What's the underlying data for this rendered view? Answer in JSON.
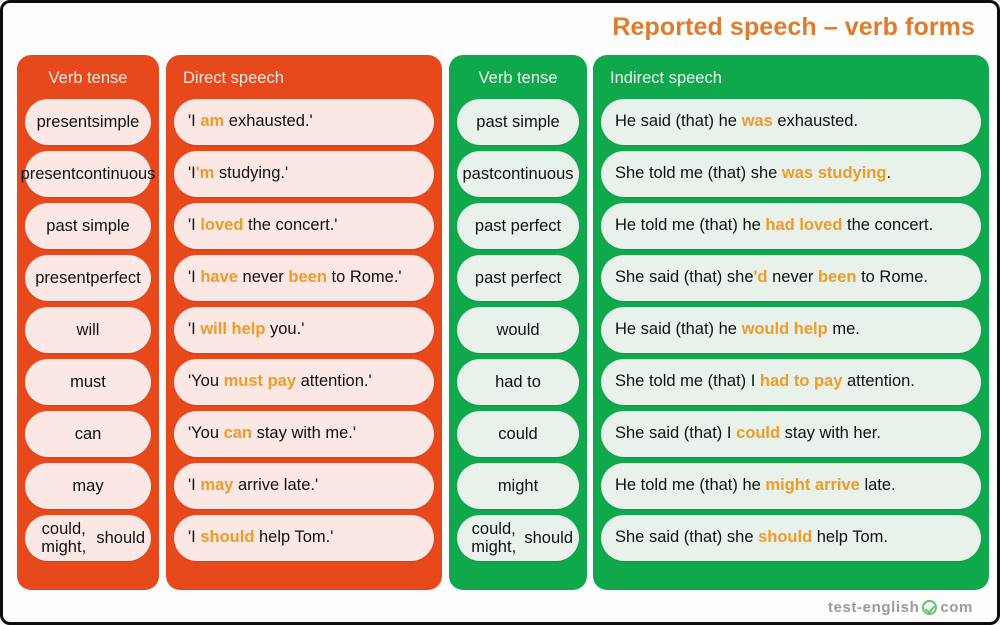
{
  "title": "Reported speech – verb forms",
  "colors": {
    "orange_panel": "#E8491C",
    "green_panel": "#10A84C",
    "orange_pill": "#FBE8E4",
    "green_pill": "#E8F2EA",
    "highlight": "#F09A27",
    "title": "#E07B29",
    "logo": "#9a9a9a",
    "check": "#62C46A"
  },
  "headers": {
    "verb_tense_direct": "Verb tense",
    "direct_speech": "Direct speech",
    "verb_tense_indirect": "Verb tense",
    "indirect_speech": "Indirect speech"
  },
  "rows": [
    {
      "direct_tense": "present simple",
      "direct_tense_lines": [
        "present",
        "simple"
      ],
      "direct_speech": "'I am exhausted.'",
      "direct_speech_html": "'I <span class=\"hl\">am</span> exhausted.'",
      "direct_highlight": [
        "am"
      ],
      "indirect_tense": "past simple",
      "indirect_tense_lines": [
        "past simple"
      ],
      "indirect_speech": "He said (that) he was exhausted.",
      "indirect_speech_html": "He said (that) he <span class=\"hl\">was</span> exhausted.",
      "indirect_highlight": [
        "was"
      ]
    },
    {
      "direct_tense": "present continuous",
      "direct_tense_lines": [
        "present",
        "continuous"
      ],
      "direct_speech": "'I'm studying.'",
      "direct_speech_html": "'I<span class=\"hl\">'m</span> studying.'",
      "direct_highlight": [
        "'m"
      ],
      "indirect_tense": "past continuous",
      "indirect_tense_lines": [
        "past",
        "continuous"
      ],
      "indirect_speech": "She told me (that) she was studying.",
      "indirect_speech_html": "She told me (that) she <span class=\"hl\">was studying</span>.",
      "indirect_highlight": [
        "was studying"
      ]
    },
    {
      "direct_tense": "past simple",
      "direct_tense_lines": [
        "past simple"
      ],
      "direct_speech": "'I loved the concert.'",
      "direct_speech_html": "'I <span class=\"hl\">loved</span> the concert.'",
      "direct_highlight": [
        "loved"
      ],
      "indirect_tense": "past perfect",
      "indirect_tense_lines": [
        "past perfect"
      ],
      "indirect_speech": "He told me (that) he had loved the concert.",
      "indirect_speech_html": "He told me (that) he <span class=\"hl\">had loved</span> the concert.",
      "indirect_highlight": [
        "had loved"
      ]
    },
    {
      "direct_tense": "present perfect",
      "direct_tense_lines": [
        "present",
        "perfect"
      ],
      "direct_speech": "'I have never been to Rome.'",
      "direct_speech_html": "'I <span class=\"hl\">have</span> never <span class=\"hl\">been</span> to Rome.'",
      "direct_highlight": [
        "have",
        "been"
      ],
      "indirect_tense": "past perfect",
      "indirect_tense_lines": [
        "past perfect"
      ],
      "indirect_speech": "She said (that) she'd never been to Rome.",
      "indirect_speech_html": "She said (that) she<span class=\"hl\">'d</span> never <span class=\"hl\">been</span> to Rome.",
      "indirect_highlight": [
        "'d",
        "been"
      ]
    },
    {
      "direct_tense": "will",
      "direct_tense_lines": [
        "will"
      ],
      "direct_speech": "'I will help you.'",
      "direct_speech_html": "'I <span class=\"hl\">will help</span> you.'",
      "direct_highlight": [
        "will help"
      ],
      "indirect_tense": "would",
      "indirect_tense_lines": [
        "would"
      ],
      "indirect_speech": "He said (that) he would help me.",
      "indirect_speech_html": "He said (that) he <span class=\"hl\">would help</span> me.",
      "indirect_highlight": [
        "would help"
      ]
    },
    {
      "direct_tense": "must",
      "direct_tense_lines": [
        "must"
      ],
      "direct_speech": "'You must pay attention.'",
      "direct_speech_html": "'You <span class=\"hl\">must pay</span> attention.'",
      "direct_highlight": [
        "must pay"
      ],
      "indirect_tense": "had to",
      "indirect_tense_lines": [
        "had to"
      ],
      "indirect_speech": "She told me (that) I had to pay attention.",
      "indirect_speech_html": "She told me (that) I <span class=\"hl\">had to pay</span> attention.",
      "indirect_highlight": [
        "had to pay"
      ]
    },
    {
      "direct_tense": "can",
      "direct_tense_lines": [
        "can"
      ],
      "direct_speech": "'You can stay with me.'",
      "direct_speech_html": "'You <span class=\"hl\">can</span> stay with me.'",
      "direct_highlight": [
        "can"
      ],
      "indirect_tense": "could",
      "indirect_tense_lines": [
        "could"
      ],
      "indirect_speech": "She said (that) I could stay with her.",
      "indirect_speech_html": "She said (that) I <span class=\"hl\">could</span> stay with her.",
      "indirect_highlight": [
        "could"
      ]
    },
    {
      "direct_tense": "may",
      "direct_tense_lines": [
        "may"
      ],
      "direct_speech": "'I may arrive late.'",
      "direct_speech_html": "'I <span class=\"hl\">may</span> arrive late.'",
      "direct_highlight": [
        "may"
      ],
      "indirect_tense": "might",
      "indirect_tense_lines": [
        "might"
      ],
      "indirect_speech": "He told me (that) he might arrive late.",
      "indirect_speech_html": "He told me (that) he <span class=\"hl\">might arrive</span> late.",
      "indirect_highlight": [
        "might arrive"
      ]
    },
    {
      "direct_tense": "could, might, should",
      "direct_tense_lines": [
        "could, might,",
        "should"
      ],
      "direct_speech": "'I should help Tom.'",
      "direct_speech_html": "'I <span class=\"hl\">should</span> help Tom.'",
      "direct_highlight": [
        "should"
      ],
      "indirect_tense": "could, might, should",
      "indirect_tense_lines": [
        "could, might,",
        "should"
      ],
      "indirect_speech": "She said (that) she should help Tom.",
      "indirect_speech_html": "She said (that) she <span class=\"hl\">should</span> help Tom.",
      "indirect_highlight": [
        "should"
      ]
    }
  ],
  "footer": {
    "logo_text_1": "test-english",
    "logo_icon": "check-circle-icon",
    "logo_text_2": "com"
  }
}
